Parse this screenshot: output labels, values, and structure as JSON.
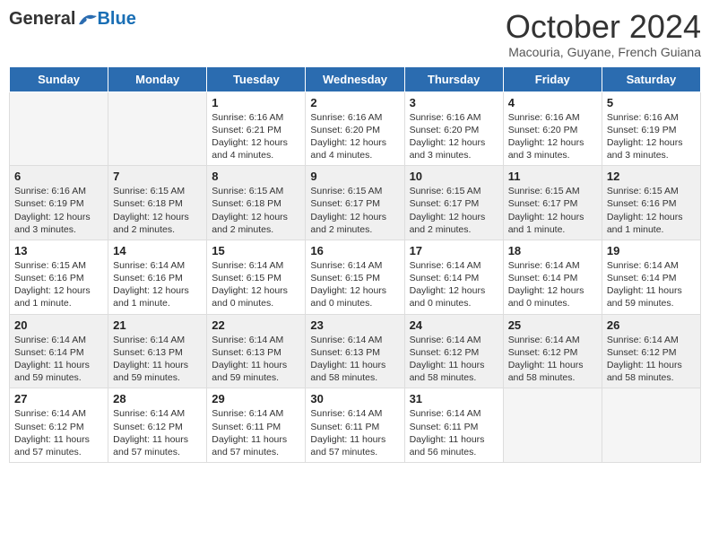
{
  "header": {
    "logo_general": "General",
    "logo_blue": "Blue",
    "month_title": "October 2024",
    "subtitle": "Macouria, Guyane, French Guiana"
  },
  "days_of_week": [
    "Sunday",
    "Monday",
    "Tuesday",
    "Wednesday",
    "Thursday",
    "Friday",
    "Saturday"
  ],
  "weeks": [
    [
      {
        "day": "",
        "empty": true
      },
      {
        "day": "",
        "empty": true
      },
      {
        "day": "1",
        "sunrise": "Sunrise: 6:16 AM",
        "sunset": "Sunset: 6:21 PM",
        "daylight": "Daylight: 12 hours and 4 minutes."
      },
      {
        "day": "2",
        "sunrise": "Sunrise: 6:16 AM",
        "sunset": "Sunset: 6:20 PM",
        "daylight": "Daylight: 12 hours and 4 minutes."
      },
      {
        "day": "3",
        "sunrise": "Sunrise: 6:16 AM",
        "sunset": "Sunset: 6:20 PM",
        "daylight": "Daylight: 12 hours and 3 minutes."
      },
      {
        "day": "4",
        "sunrise": "Sunrise: 6:16 AM",
        "sunset": "Sunset: 6:20 PM",
        "daylight": "Daylight: 12 hours and 3 minutes."
      },
      {
        "day": "5",
        "sunrise": "Sunrise: 6:16 AM",
        "sunset": "Sunset: 6:19 PM",
        "daylight": "Daylight: 12 hours and 3 minutes."
      }
    ],
    [
      {
        "day": "6",
        "sunrise": "Sunrise: 6:16 AM",
        "sunset": "Sunset: 6:19 PM",
        "daylight": "Daylight: 12 hours and 3 minutes."
      },
      {
        "day": "7",
        "sunrise": "Sunrise: 6:15 AM",
        "sunset": "Sunset: 6:18 PM",
        "daylight": "Daylight: 12 hours and 2 minutes."
      },
      {
        "day": "8",
        "sunrise": "Sunrise: 6:15 AM",
        "sunset": "Sunset: 6:18 PM",
        "daylight": "Daylight: 12 hours and 2 minutes."
      },
      {
        "day": "9",
        "sunrise": "Sunrise: 6:15 AM",
        "sunset": "Sunset: 6:17 PM",
        "daylight": "Daylight: 12 hours and 2 minutes."
      },
      {
        "day": "10",
        "sunrise": "Sunrise: 6:15 AM",
        "sunset": "Sunset: 6:17 PM",
        "daylight": "Daylight: 12 hours and 2 minutes."
      },
      {
        "day": "11",
        "sunrise": "Sunrise: 6:15 AM",
        "sunset": "Sunset: 6:17 PM",
        "daylight": "Daylight: 12 hours and 1 minute."
      },
      {
        "day": "12",
        "sunrise": "Sunrise: 6:15 AM",
        "sunset": "Sunset: 6:16 PM",
        "daylight": "Daylight: 12 hours and 1 minute."
      }
    ],
    [
      {
        "day": "13",
        "sunrise": "Sunrise: 6:15 AM",
        "sunset": "Sunset: 6:16 PM",
        "daylight": "Daylight: 12 hours and 1 minute."
      },
      {
        "day": "14",
        "sunrise": "Sunrise: 6:14 AM",
        "sunset": "Sunset: 6:16 PM",
        "daylight": "Daylight: 12 hours and 1 minute."
      },
      {
        "day": "15",
        "sunrise": "Sunrise: 6:14 AM",
        "sunset": "Sunset: 6:15 PM",
        "daylight": "Daylight: 12 hours and 0 minutes."
      },
      {
        "day": "16",
        "sunrise": "Sunrise: 6:14 AM",
        "sunset": "Sunset: 6:15 PM",
        "daylight": "Daylight: 12 hours and 0 minutes."
      },
      {
        "day": "17",
        "sunrise": "Sunrise: 6:14 AM",
        "sunset": "Sunset: 6:14 PM",
        "daylight": "Daylight: 12 hours and 0 minutes."
      },
      {
        "day": "18",
        "sunrise": "Sunrise: 6:14 AM",
        "sunset": "Sunset: 6:14 PM",
        "daylight": "Daylight: 12 hours and 0 minutes."
      },
      {
        "day": "19",
        "sunrise": "Sunrise: 6:14 AM",
        "sunset": "Sunset: 6:14 PM",
        "daylight": "Daylight: 11 hours and 59 minutes."
      }
    ],
    [
      {
        "day": "20",
        "sunrise": "Sunrise: 6:14 AM",
        "sunset": "Sunset: 6:14 PM",
        "daylight": "Daylight: 11 hours and 59 minutes."
      },
      {
        "day": "21",
        "sunrise": "Sunrise: 6:14 AM",
        "sunset": "Sunset: 6:13 PM",
        "daylight": "Daylight: 11 hours and 59 minutes."
      },
      {
        "day": "22",
        "sunrise": "Sunrise: 6:14 AM",
        "sunset": "Sunset: 6:13 PM",
        "daylight": "Daylight: 11 hours and 59 minutes."
      },
      {
        "day": "23",
        "sunrise": "Sunrise: 6:14 AM",
        "sunset": "Sunset: 6:13 PM",
        "daylight": "Daylight: 11 hours and 58 minutes."
      },
      {
        "day": "24",
        "sunrise": "Sunrise: 6:14 AM",
        "sunset": "Sunset: 6:12 PM",
        "daylight": "Daylight: 11 hours and 58 minutes."
      },
      {
        "day": "25",
        "sunrise": "Sunrise: 6:14 AM",
        "sunset": "Sunset: 6:12 PM",
        "daylight": "Daylight: 11 hours and 58 minutes."
      },
      {
        "day": "26",
        "sunrise": "Sunrise: 6:14 AM",
        "sunset": "Sunset: 6:12 PM",
        "daylight": "Daylight: 11 hours and 58 minutes."
      }
    ],
    [
      {
        "day": "27",
        "sunrise": "Sunrise: 6:14 AM",
        "sunset": "Sunset: 6:12 PM",
        "daylight": "Daylight: 11 hours and 57 minutes."
      },
      {
        "day": "28",
        "sunrise": "Sunrise: 6:14 AM",
        "sunset": "Sunset: 6:12 PM",
        "daylight": "Daylight: 11 hours and 57 minutes."
      },
      {
        "day": "29",
        "sunrise": "Sunrise: 6:14 AM",
        "sunset": "Sunset: 6:11 PM",
        "daylight": "Daylight: 11 hours and 57 minutes."
      },
      {
        "day": "30",
        "sunrise": "Sunrise: 6:14 AM",
        "sunset": "Sunset: 6:11 PM",
        "daylight": "Daylight: 11 hours and 57 minutes."
      },
      {
        "day": "31",
        "sunrise": "Sunrise: 6:14 AM",
        "sunset": "Sunset: 6:11 PM",
        "daylight": "Daylight: 11 hours and 56 minutes."
      },
      {
        "day": "",
        "empty": true
      },
      {
        "day": "",
        "empty": true
      }
    ]
  ]
}
